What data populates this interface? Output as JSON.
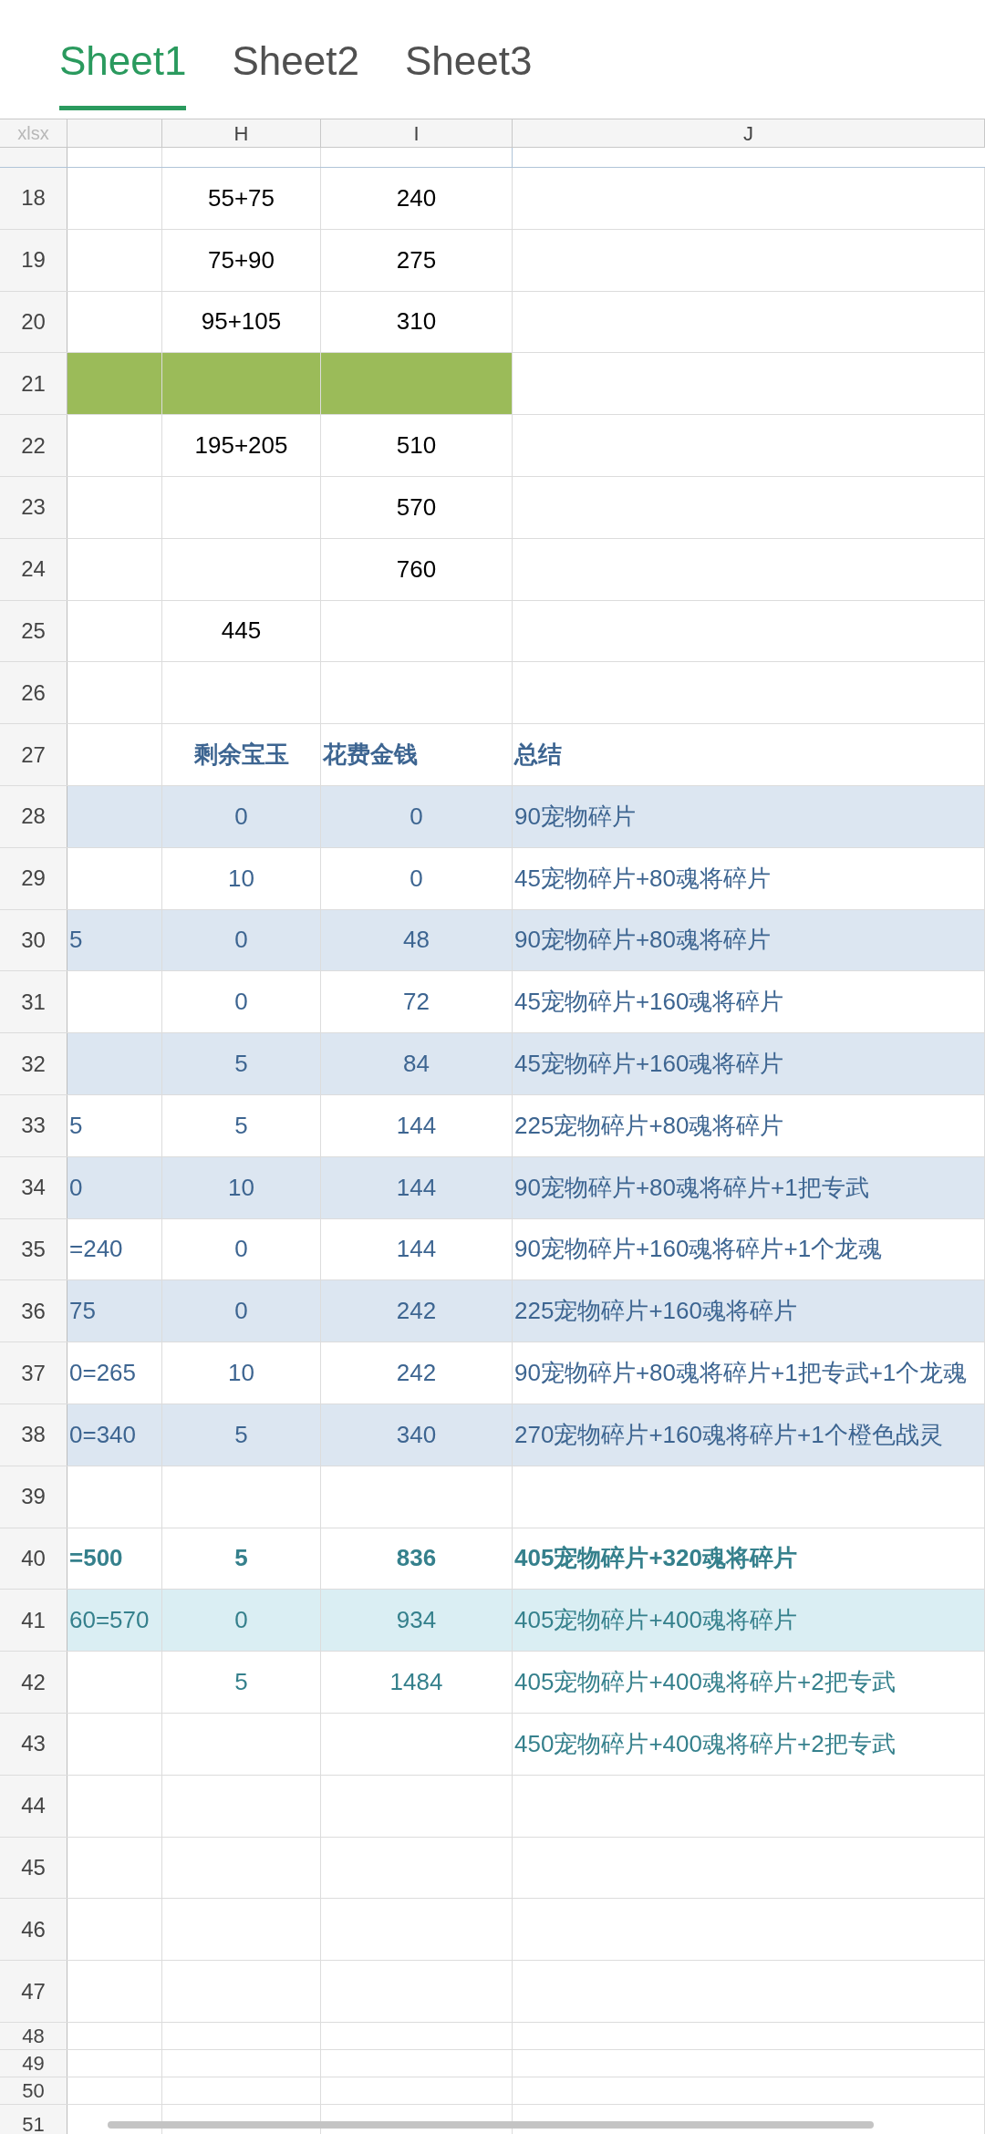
{
  "tabs": [
    {
      "label": "Sheet1",
      "selected": true
    },
    {
      "label": "Sheet2",
      "selected": false
    },
    {
      "label": "Sheet3",
      "selected": false
    }
  ],
  "corner": "xlsx",
  "columns": [
    "H",
    "I",
    "J"
  ],
  "rows": [
    {
      "number": "18",
      "kind": "plain",
      "cells": {
        "H": "55+75",
        "I": "240"
      }
    },
    {
      "number": "19",
      "kind": "plain",
      "cells": {
        "H": "75+90",
        "I": "275"
      }
    },
    {
      "number": "20",
      "kind": "plain",
      "cells": {
        "H": "95+105",
        "I": "310"
      }
    },
    {
      "number": "21",
      "kind": "green",
      "cells": {}
    },
    {
      "number": "22",
      "kind": "plain",
      "cells": {
        "H": "195+205",
        "I": "510"
      }
    },
    {
      "number": "23",
      "kind": "plain",
      "cells": {
        "I": "570"
      }
    },
    {
      "number": "24",
      "kind": "plain",
      "cells": {
        "I": "760"
      }
    },
    {
      "number": "25",
      "kind": "plain",
      "cells": {
        "H": "445"
      }
    },
    {
      "number": "26",
      "kind": "plain",
      "cells": {}
    },
    {
      "number": "27",
      "kind": "header",
      "cells": {
        "H": "剩余宝玉",
        "I": "花费金钱",
        "J": "总结"
      }
    },
    {
      "number": "28",
      "kind": "band",
      "cells": {
        "H": "0",
        "I": "0",
        "J": "90宠物碎片"
      }
    },
    {
      "number": "29",
      "kind": "blue",
      "cells": {
        "H": "10",
        "I": "0",
        "J": "45宠物碎片+80魂将碎片"
      }
    },
    {
      "number": "30",
      "kind": "band",
      "cells": {
        "column_1": "5",
        "H": "0",
        "I": "48",
        "J": "90宠物碎片+80魂将碎片"
      }
    },
    {
      "number": "31",
      "kind": "blue",
      "cells": {
        "H": "0",
        "I": "72",
        "J": "45宠物碎片+160魂将碎片"
      }
    },
    {
      "number": "32",
      "kind": "band",
      "cells": {
        "H": "5",
        "I": "84",
        "J": "45宠物碎片+160魂将碎片"
      }
    },
    {
      "number": "33",
      "kind": "blue",
      "cells": {
        "column_1": "5",
        "H": "5",
        "I": "144",
        "J": "225宠物碎片+80魂将碎片"
      }
    },
    {
      "number": "34",
      "kind": "band",
      "cells": {
        "column_1": "0",
        "H": "10",
        "I": "144",
        "J": "90宠物碎片+80魂将碎片+1把专武"
      }
    },
    {
      "number": "35",
      "kind": "blue",
      "cells": {
        "column_1": "=240",
        "H": "0",
        "I": "144",
        "J": "90宠物碎片+160魂将碎片+1个龙魂"
      }
    },
    {
      "number": "36",
      "kind": "band",
      "cells": {
        "column_1": "75",
        "H": "0",
        "I": "242",
        "J": "225宠物碎片+160魂将碎片"
      }
    },
    {
      "number": "37",
      "kind": "blue",
      "cells": {
        "column_1": "0=265",
        "H": "10",
        "I": "242",
        "J": "90宠物碎片+80魂将碎片+1把专武+1个龙魂"
      }
    },
    {
      "number": "38",
      "kind": "band",
      "cells": {
        "column_1": "0=340",
        "H": "5",
        "I": "340",
        "J": "270宠物碎片+160魂将碎片+1个橙色战灵"
      }
    },
    {
      "number": "39",
      "kind": "plain",
      "cells": {}
    },
    {
      "number": "40",
      "kind": "bold-teal",
      "cells": {
        "column_1": "=500",
        "H": "5",
        "I": "836",
        "J": "405宠物碎片+320魂将碎片"
      }
    },
    {
      "number": "41",
      "kind": "cyan",
      "cells": {
        "column_1": "60=570",
        "H": "0",
        "I": "934",
        "J": "405宠物碎片+400魂将碎片"
      }
    },
    {
      "number": "42",
      "kind": "teal",
      "cells": {
        "H": "5",
        "I": "1484",
        "J": "405宠物碎片+400魂将碎片+2把专武"
      }
    },
    {
      "number": "43",
      "kind": "teal",
      "cells": {
        "J": "450宠物碎片+400魂将碎片+2把专武"
      }
    },
    {
      "number": "44",
      "kind": "plain",
      "cells": {}
    },
    {
      "number": "45",
      "kind": "plain",
      "cells": {}
    },
    {
      "number": "46",
      "kind": "plain",
      "cells": {}
    },
    {
      "number": "47",
      "kind": "plain",
      "cells": {}
    },
    {
      "number": "48",
      "kind": "plain",
      "cells": {}
    },
    {
      "number": "49",
      "kind": "plain",
      "cells": {}
    },
    {
      "number": "50",
      "kind": "plain",
      "cells": {}
    },
    {
      "number": "51",
      "kind": "plain",
      "cells": {}
    }
  ]
}
